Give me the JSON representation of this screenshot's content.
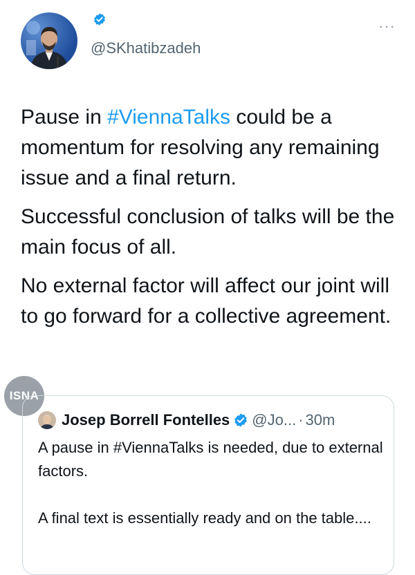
{
  "author": {
    "handle": "@SKhatibzadeh",
    "verified_color": "#1d9bf0"
  },
  "more_label": "···",
  "tweet": {
    "p1_before": "Pause in ",
    "p1_hashtag": "#ViennaTalks",
    "p1_after": " could be a momentum for resolving any remaining issue and a final return.",
    "p2": "Successful conclusion of talks will be the main focus of all.",
    "p3": "No external factor will affect our joint will to go forward for a collective agreement."
  },
  "watermark": "ISNA",
  "quote": {
    "name": "Josep Borrell Fontelles",
    "handle": "@Jo...",
    "separator": "·",
    "time": "30m",
    "p1": "A pause in #ViennaTalks is needed, due to external factors.",
    "p2": "A final text is essentially ready and on the table...."
  },
  "colors": {
    "hashtag": "#1d9bf0",
    "secondary_text": "#536471",
    "border": "#cfd9de"
  }
}
